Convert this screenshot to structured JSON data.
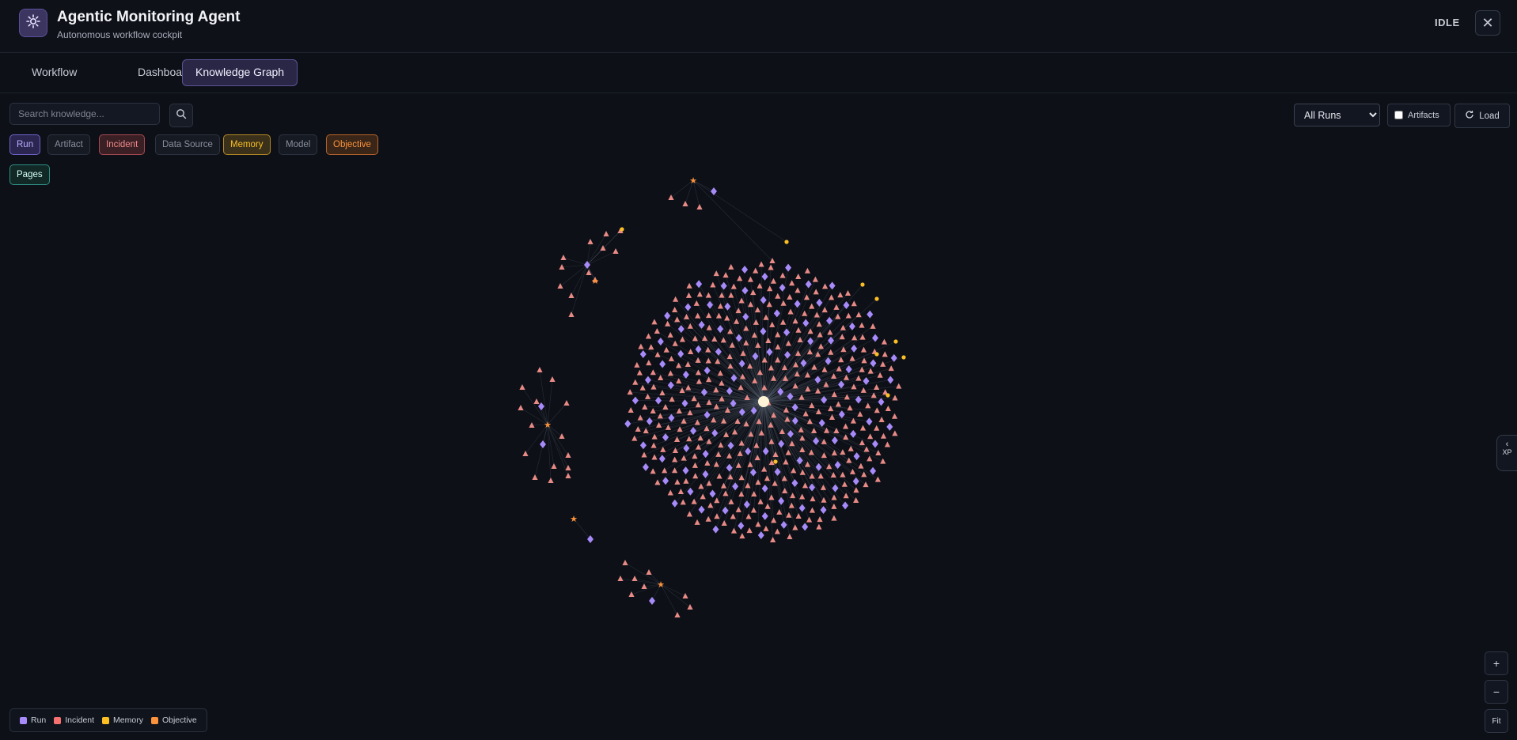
{
  "header": {
    "title": "Agentic Monitoring Agent",
    "subtitle": "Autonomous workflow cockpit",
    "status": "IDLE",
    "close_icon": "close-icon"
  },
  "tabs": [
    {
      "label": "Workflow"
    },
    {
      "label": "Dashboard"
    },
    {
      "label": "Knowledge Graph",
      "active": true
    }
  ],
  "search": {
    "placeholder": "Search knowledge..."
  },
  "filters": [
    {
      "label": "Run",
      "color": "#a78bfa",
      "active": true
    },
    {
      "label": "Artifact",
      "color": "#8b8f9c",
      "active": false
    },
    {
      "label": "Incident",
      "color": "#f87171",
      "active": true
    },
    {
      "label": "Data Source",
      "color": "#8b8f9c",
      "active": false
    },
    {
      "label": "Memory",
      "color": "#fbbf24",
      "active": true
    },
    {
      "label": "Model",
      "color": "#8b8f9c",
      "active": false
    },
    {
      "label": "Objective",
      "color": "#fb923c",
      "active": true
    },
    {
      "label": "Pages",
      "color": "#5eead4",
      "active": true
    }
  ],
  "controls": {
    "run_select": {
      "selected": "All Runs",
      "options": [
        "All Runs"
      ]
    },
    "artifacts_label": "Artifacts",
    "artifacts_checked": false,
    "load_label": "Load",
    "xp_label": "XP",
    "zoom_in": "+",
    "zoom_out": "−",
    "fit": "Fit"
  },
  "legend": [
    {
      "label": "Run",
      "color": "#a78bfa"
    },
    {
      "label": "Incident",
      "color": "#f87171"
    },
    {
      "label": "Memory",
      "color": "#fbbf24"
    },
    {
      "label": "Objective",
      "color": "#fb923c"
    }
  ],
  "colors": {
    "run": "#a78bfa",
    "incident": "#f87171",
    "memory": "#fbbf24",
    "objective": "#fb923c",
    "accent": "#7c6cf0"
  }
}
